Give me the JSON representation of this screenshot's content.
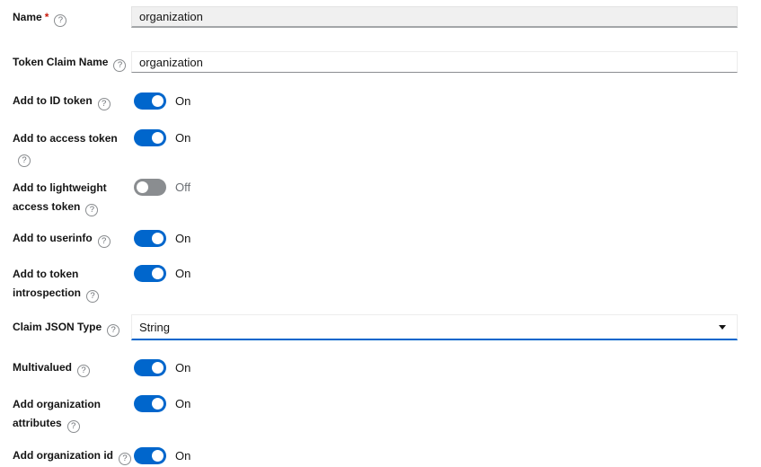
{
  "form": {
    "required_marker": "*",
    "fields": [
      {
        "label": "Name",
        "required": true,
        "control": "text",
        "value": "organization",
        "disabled": true
      },
      {
        "label": "Token Claim Name",
        "control": "text",
        "value": "organization"
      },
      {
        "label": "Add to ID token",
        "control": "switch",
        "state": "On"
      },
      {
        "label": "Add to access token",
        "control": "switch",
        "state": "On"
      },
      {
        "label": "Add to lightweight access token",
        "control": "switch",
        "state": "Off"
      },
      {
        "label": "Add to userinfo",
        "control": "switch",
        "state": "On"
      },
      {
        "label": "Add to token introspection",
        "control": "switch",
        "state": "On"
      },
      {
        "label": "Claim JSON Type",
        "control": "select",
        "value": "String"
      },
      {
        "label": "Multivalued",
        "control": "switch",
        "state": "On"
      },
      {
        "label": "Add organization attributes",
        "control": "switch",
        "state": "On"
      },
      {
        "label": "Add organization id",
        "control": "switch",
        "state": "On"
      }
    ],
    "icons": {
      "help": "question-circle-icon",
      "select_caret": "caret-down-icon"
    },
    "colors": {
      "switch_on": "#0066cc",
      "switch_off": "#8a8d90",
      "required_asterisk": "#c9190b",
      "select_focus_border": "#0066cc",
      "disabled_input_bg": "#f0f0f0",
      "label_text": "#151515",
      "muted_text": "#6a6e73"
    }
  }
}
